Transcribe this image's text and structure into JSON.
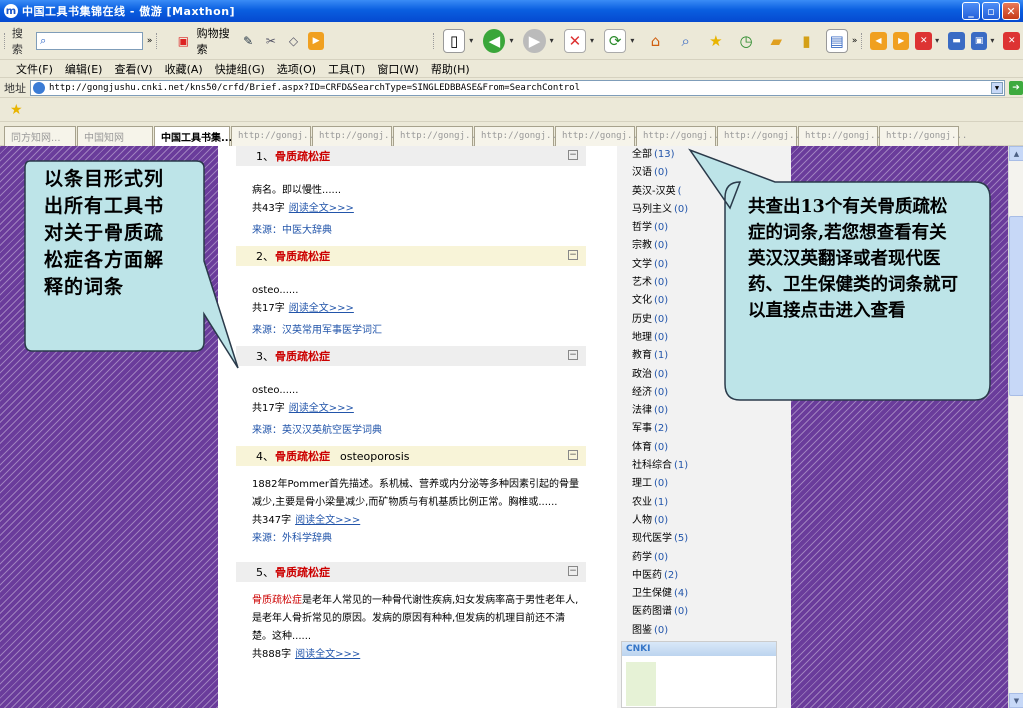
{
  "window": {
    "title": "中国工具书集锦在线 - 傲游 [Maxthon]"
  },
  "toolbar": {
    "search_label": "搜索",
    "shopping_label": "购物搜索"
  },
  "menu": [
    "文件(F)",
    "编辑(E)",
    "查看(V)",
    "收藏(A)",
    "快捷组(G)",
    "选项(O)",
    "工具(T)",
    "窗口(W)",
    "帮助(H)"
  ],
  "address": {
    "label": "地址",
    "url": "http://gongjushu.cnki.net/kns50/crfd/Brief.aspx?ID=CRFD&SearchType=SINGLEDBBASE&From=SearchControl"
  },
  "tabs": [
    {
      "label": "同方知网..."
    },
    {
      "label": "中国知网"
    },
    {
      "label": "中国工具书集..."
    },
    {
      "label": "http://gongj..."
    },
    {
      "label": "http://gongj..."
    },
    {
      "label": "http://gongj..."
    },
    {
      "label": "http://gongj..."
    },
    {
      "label": "http://gongj..."
    },
    {
      "label": "http://gongj..."
    },
    {
      "label": "http://gongj..."
    },
    {
      "label": "http://gongj..."
    },
    {
      "label": "http://gongj..."
    }
  ],
  "results": [
    {
      "num": "1、",
      "term": "骨质疏松症",
      "extra": "",
      "lines": [
        "病名。即以慢性......"
      ],
      "count": "共43字",
      "read": "阅读全文>>>",
      "source": "来源：中医大辞典"
    },
    {
      "num": "2、",
      "term": "骨质疏松症",
      "extra": "",
      "lines": [
        "osteo......"
      ],
      "count": "共17字",
      "read": "阅读全文>>>",
      "source": "来源：汉英常用军事医学词汇"
    },
    {
      "num": "3、",
      "term": "骨质疏松症",
      "extra": "",
      "lines": [
        "osteo......"
      ],
      "count": "共17字",
      "read": "阅读全文>>>",
      "source": "来源：英汉汉英航空医学词典"
    },
    {
      "num": "4、",
      "term": "骨质疏松症",
      "extra": "osteoporosis",
      "lines": [
        "1882年Pommer首先描述。系机械、营养或内分泌等多种因素引起的骨量",
        "减少,主要是骨小梁量减少,而矿物质与有机基质比例正常。胸椎或......"
      ],
      "count": "共347字",
      "read": "阅读全文>>>",
      "source": "来源：外科学辞典"
    },
    {
      "num": "5、",
      "term": "骨质疏松症",
      "extra": "",
      "lines_hl": "骨质疏松症",
      "lines": [
        "是老年人常见的一种骨代谢性疾病,妇女发病率高于男性老年人,",
        "是老年人骨折常见的原因。发病的原因有种种,但发病的机理目前还不清",
        "楚。这种......"
      ],
      "count": "共888字",
      "read": "阅读全文>>>",
      "source": ""
    }
  ],
  "categories": [
    {
      "name": "全部",
      "count": "(13)"
    },
    {
      "name": "汉语",
      "count": "(0)"
    },
    {
      "name": "英汉-汉英",
      "count": "("
    },
    {
      "name": "马列主义",
      "count": "(0)"
    },
    {
      "name": "哲学",
      "count": "(0)"
    },
    {
      "name": "宗教",
      "count": "(0)"
    },
    {
      "name": "文学",
      "count": "(0)"
    },
    {
      "name": "艺术",
      "count": "(0)"
    },
    {
      "name": "文化",
      "count": "(0)"
    },
    {
      "name": "历史",
      "count": "(0)"
    },
    {
      "name": "地理",
      "count": "(0)"
    },
    {
      "name": "教育",
      "count": "(1)"
    },
    {
      "name": "政治",
      "count": "(0)"
    },
    {
      "name": "经济",
      "count": "(0)"
    },
    {
      "name": "法律",
      "count": "(0)"
    },
    {
      "name": "军事",
      "count": "(2)"
    },
    {
      "name": "体育",
      "count": "(0)"
    },
    {
      "name": "社科综合",
      "count": "(1)"
    },
    {
      "name": "理工",
      "count": "(0)"
    },
    {
      "name": "农业",
      "count": "(1)"
    },
    {
      "name": "人物",
      "count": "(0)"
    },
    {
      "name": "现代医学",
      "count": "(5)"
    },
    {
      "name": "药学",
      "count": "(0)"
    },
    {
      "name": "中医药",
      "count": "(2)"
    },
    {
      "name": "卫生保健",
      "count": "(4)"
    },
    {
      "name": "医药图谱",
      "count": "(0)"
    },
    {
      "name": "图鉴",
      "count": "(0)"
    }
  ],
  "callouts": {
    "left": "以条目形式列出所有工具书对关于骨质疏松症各方面解释的词条",
    "right": "共查出13个有关骨质疏松症的词条,若您想查看有关英汉汉英翻译或者现代医药、卫生保健类的词条就可以直接点击进入查看"
  },
  "colors": {
    "titlebar": "#0a5fe0",
    "background_stripes": "#6a3c9b",
    "callout_fill": "#bde4e8",
    "highlight_term": "#cc0000",
    "link": "#2255aa"
  },
  "icons": [
    "search-icon",
    "cart-icon",
    "new-page-icon",
    "back-icon",
    "forward-icon",
    "stop-icon",
    "refresh-icon",
    "home-icon",
    "find-icon",
    "favorites-icon",
    "history-icon",
    "folder-icon",
    "notes-icon",
    "layout-icon",
    "go-icon",
    "star-icon"
  ]
}
